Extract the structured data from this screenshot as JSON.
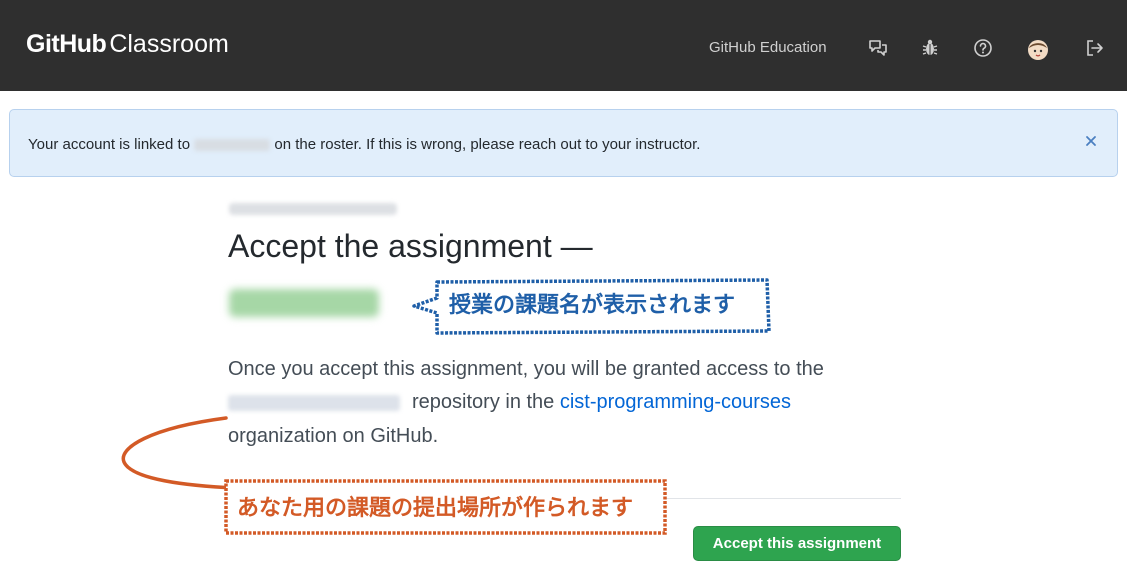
{
  "header": {
    "logo_github": "GitHub",
    "logo_classroom": "Classroom",
    "nav_education": "GitHub Education",
    "icons": [
      "feedback-icon",
      "bug-icon",
      "help-icon",
      "avatar",
      "sign-out-icon"
    ]
  },
  "flash": {
    "text_before": "Your account is linked to",
    "text_after": "on the roster. If this is wrong, please reach out to your instructor.",
    "close_symbol": "×"
  },
  "main": {
    "title": "Accept the assignment —",
    "description_line1": "Once you accept this assignment, you will be granted access to the",
    "description_line2_after": "repository in the",
    "org_link": "cist-programming-courses",
    "description_line3": "organization on GitHub.",
    "accept_button": "Accept this assignment"
  },
  "annotations": {
    "callout_assignment_name": "授業の課題名が表示されます",
    "callout_repository": "あなた用の課題の提出場所が作られます"
  },
  "colors": {
    "header_bg": "#2f2f2f",
    "flash_bg": "#e1eefb",
    "link": "#0366d6",
    "button_green": "#2ea44f",
    "annotation_blue": "#1f5fa8",
    "annotation_orange": "#d35a26"
  }
}
